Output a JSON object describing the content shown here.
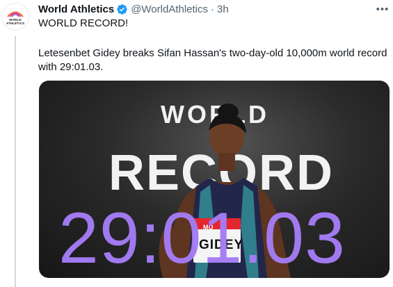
{
  "tweet": {
    "display_name": "World Athletics",
    "handle": "@WorldAthletics",
    "separator": "·",
    "time": "3h",
    "more_label": "•••",
    "text_line_1": "WORLD RECORD!",
    "text_line_2": "Letesenbet Gidey breaks Sifan Hassan's two-day-old 10,000m world record",
    "text_line_3": "with 29:01.03."
  },
  "avatar": {
    "logo_line_1": "WORLD",
    "logo_line_2": "ATHLETICS"
  },
  "media": {
    "word_1": "WORLD",
    "word_2": "RECORD",
    "time": "29:01.03",
    "bib_name": "GIDEY",
    "bib_top": "MO"
  },
  "colors": {
    "verified": "#1d9bf0",
    "record_time": "#a57cf6",
    "muted": "#536471",
    "logo_orange": "#f26a3d",
    "logo_purple": "#9b5de5"
  }
}
